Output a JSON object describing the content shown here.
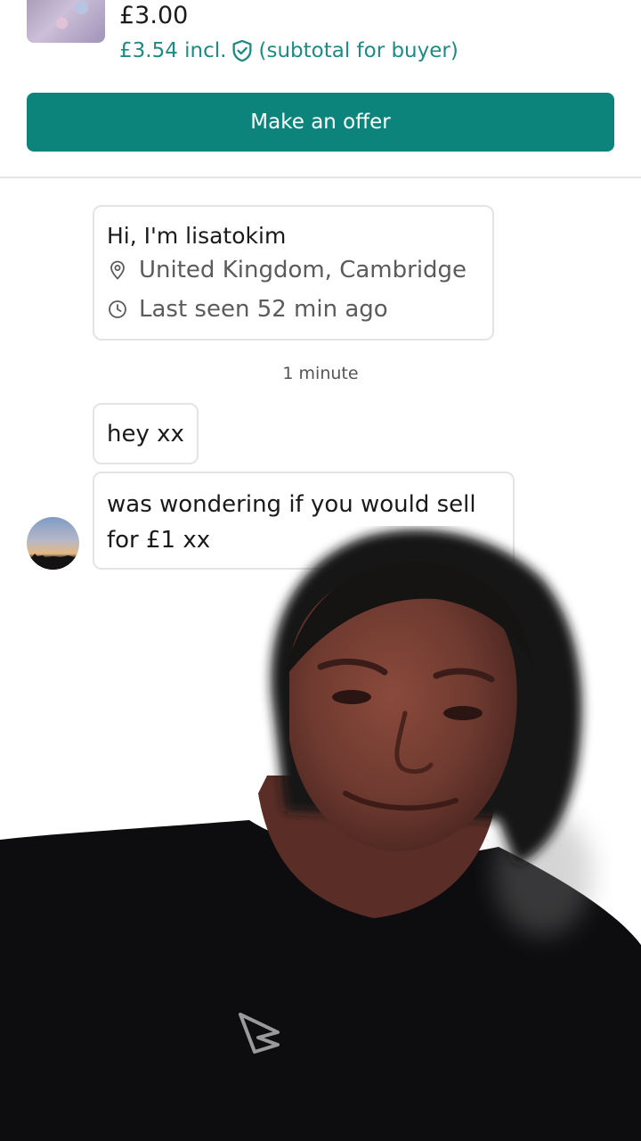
{
  "listing": {
    "price": "£3.00",
    "price_incl": "£3.54 incl.",
    "subtotal_note": "(subtotal for buyer)",
    "offer_button": "Make an offer"
  },
  "profile": {
    "greeting": "Hi, I'm lisatokim",
    "location": "United Kingdom, Cambridge",
    "last_seen": "Last seen 52 min ago"
  },
  "chat": {
    "timestamp": "1 minute",
    "messages": [
      {
        "lines": [
          "hey xx"
        ]
      },
      {
        "lines": [
          "was wondering if you would sell",
          "for £1 xx"
        ]
      }
    ]
  },
  "colors": {
    "accent": "#0c847c",
    "accent_text": "#1f8a82",
    "border": "#e4e4e4",
    "muted_text": "#5b5b5b"
  },
  "icons": {
    "protection": "shield-check-icon",
    "location": "location-pin-icon",
    "clock": "clock-icon"
  }
}
